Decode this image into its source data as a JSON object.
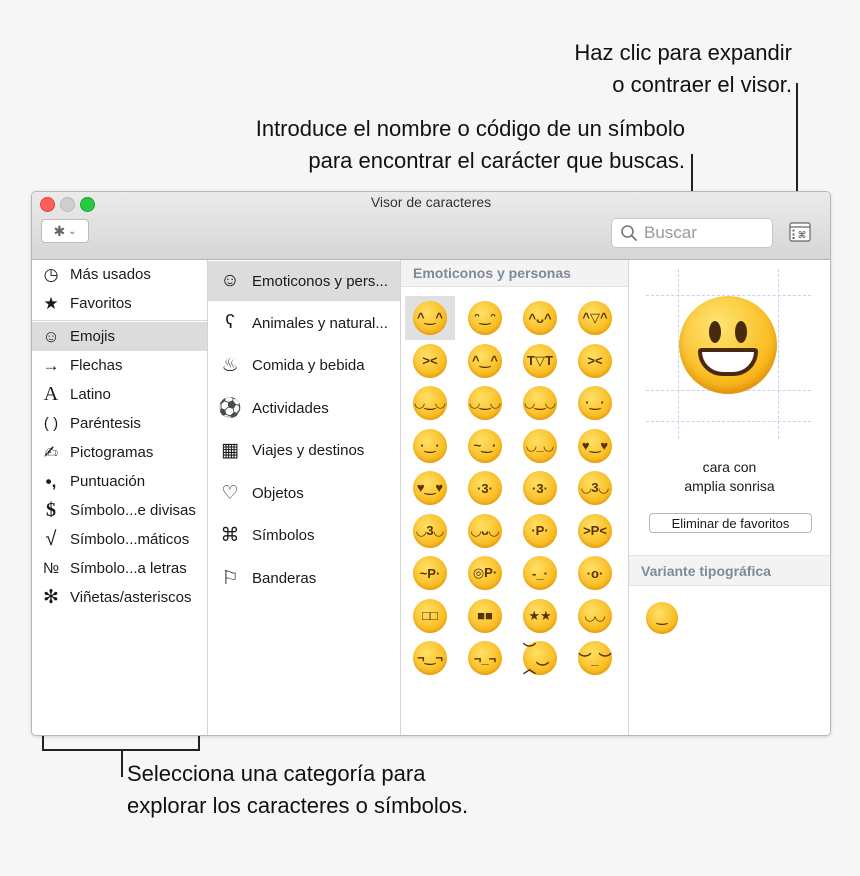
{
  "callouts": {
    "expand_line1": "Haz clic para expandir",
    "expand_line2": "o contraer el visor.",
    "search_line1": "Introduce el nombre o código de un símbolo",
    "search_line2": "para encontrar el carácter que buscas.",
    "category_line1": "Selecciona una categoría para",
    "category_line2": "explorar los caracteres o símbolos."
  },
  "window": {
    "title": "Visor de caracteres",
    "search_placeholder": "Buscar"
  },
  "sidebar": {
    "items": [
      {
        "label": "Más usados",
        "icon": "clock-icon",
        "glyph": "◷"
      },
      {
        "label": "Favoritos",
        "icon": "star-icon",
        "glyph": "★"
      },
      {
        "label": "Emojis",
        "icon": "smiley-icon",
        "glyph": "☺",
        "selected": true
      },
      {
        "label": "Flechas",
        "icon": "arrow-icon",
        "glyph": "→"
      },
      {
        "label": "Latino",
        "icon": "latin-a-icon",
        "glyph": "A"
      },
      {
        "label": "Paréntesis",
        "icon": "parentheses-icon",
        "glyph": "( )"
      },
      {
        "label": "Pictogramas",
        "icon": "pictogram-icon",
        "glyph": "✍"
      },
      {
        "label": "Puntuación",
        "icon": "punctuation-icon",
        "glyph": "•,"
      },
      {
        "label": "Símbolo...e divisas",
        "icon": "currency-icon",
        "glyph": "$"
      },
      {
        "label": "Símbolo...máticos",
        "icon": "math-root-icon",
        "glyph": "√"
      },
      {
        "label": "Símbolo...a letras",
        "icon": "numero-icon",
        "glyph": "№"
      },
      {
        "label": "Viñetas/asteriscos",
        "icon": "asterisk-icon",
        "glyph": "✻"
      }
    ]
  },
  "categories": {
    "items": [
      {
        "label": "Emoticonos y pers...",
        "icon": "smiley-icon",
        "glyph": "☺",
        "selected": true
      },
      {
        "label": "Animales y natural...",
        "icon": "bear-icon",
        "glyph": "ʕ"
      },
      {
        "label": "Comida y bebida",
        "icon": "food-icon",
        "glyph": "♨"
      },
      {
        "label": "Actividades",
        "icon": "soccer-ball-icon",
        "glyph": "⚽"
      },
      {
        "label": "Viajes y destinos",
        "icon": "building-icon",
        "glyph": "▦"
      },
      {
        "label": "Objetos",
        "icon": "lightbulb-icon",
        "glyph": "♡"
      },
      {
        "label": "Símbolos",
        "icon": "symbols-icon",
        "glyph": "⌘"
      },
      {
        "label": "Banderas",
        "icon": "flag-icon",
        "glyph": "⚐"
      }
    ]
  },
  "emoji_grid": {
    "header": "Emoticonos y personas",
    "emojis": [
      "grinning-face",
      "grinning-face-big-eyes",
      "grinning-smiling-eyes",
      "beaming-face",
      "squinting-laughing",
      "sweat-smile",
      "tears-of-joy",
      "rolling-laughing",
      "smiling-face",
      "smiling-eyes",
      "halo",
      "slight-smile",
      "upside-down",
      "winking",
      "relieved",
      "heart-eyes",
      "smiling-hearts",
      "blowing-kiss",
      "kissing",
      "kissing-smiling-eyes",
      "kissing-closed-eyes",
      "savoring",
      "tongue-out",
      "squinting-tongue",
      "winking-tongue",
      "zany",
      "raised-eyebrow",
      "monocle",
      "nerd",
      "sunglasses",
      "star-struck",
      "partying",
      "smirking",
      "unamused",
      "disappointed",
      "pensive"
    ],
    "faces": [
      "^‿^",
      "ᵔ‿ᵔ",
      "^ᴗ^",
      "^▽^",
      "><",
      "^‿^",
      "T▽T",
      "><",
      "◡‿◡",
      "◡‿◡",
      "◡‿◡",
      "·‿·",
      "·‿·",
      "~‿·",
      "◡_◡",
      "♥‿♥",
      "♥‿♥",
      "·3·",
      "·3·",
      "◡3◡",
      "◡3◡",
      "◡ᴗ◡",
      "·P·",
      ">P<",
      "~P·",
      "◎P·",
      "-_·",
      "·o·",
      "□□",
      "■■",
      "★★",
      "◡◡",
      "¬‿¬",
      "¬_¬",
      "︶︿︶",
      "︶_︶"
    ],
    "selected_index": 0
  },
  "preview": {
    "name_line1": "cara con",
    "name_line2": "amplia sonrisa",
    "remove_favorites_label": "Eliminar de favoritos",
    "variant_header": "Variante tipográfica",
    "variant_emoji": "grinning-face"
  },
  "colors": {
    "emoji_fill": "#f9b91b",
    "header_text": "#7e8a99",
    "selection": "#dcdcdc"
  }
}
